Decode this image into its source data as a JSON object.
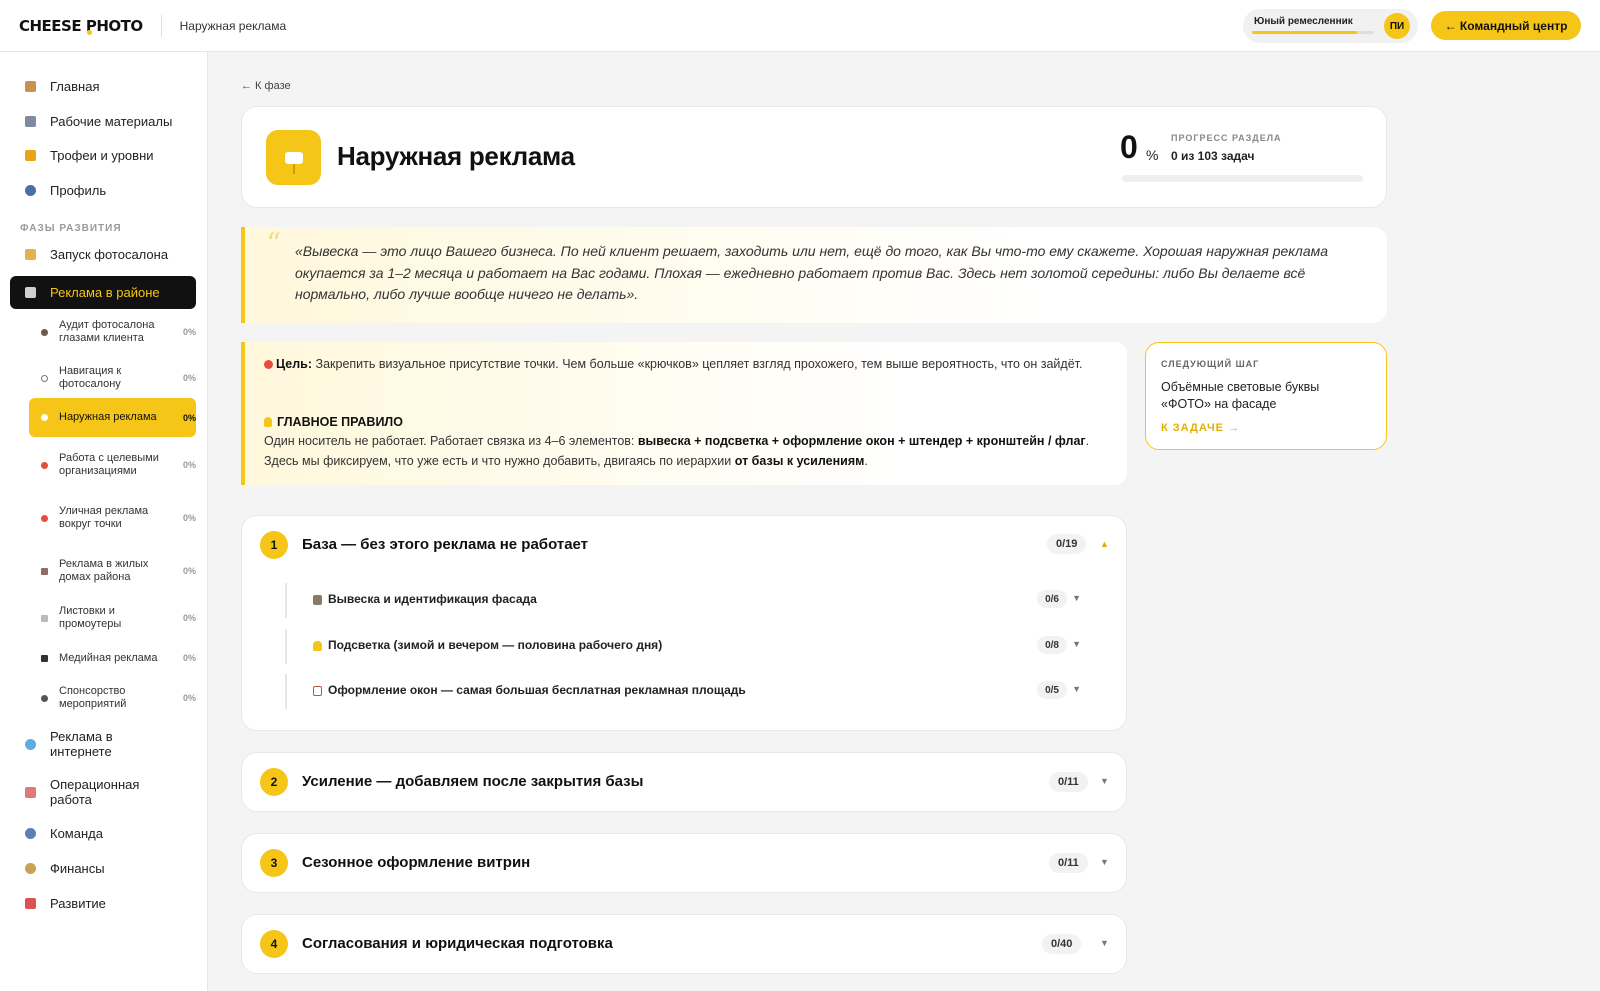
{
  "topbar": {
    "logo": "CHEESE PHOTO",
    "breadcrumb": "Наружная реклама",
    "rank_name": "Юный ремесленник",
    "rank_progress": 0.86,
    "avatar_initials": "ПИ",
    "command_button": "← Командный центр"
  },
  "sidebar": {
    "main_items": [
      {
        "label": "Главная",
        "icon": "home-icon"
      },
      {
        "label": "Рабочие материалы",
        "icon": "folder-icon"
      },
      {
        "label": "Трофеи и уровни",
        "icon": "trophy-icon"
      },
      {
        "label": "Профиль",
        "icon": "user-icon"
      }
    ],
    "section_label": "ФАЗЫ РАЗВИТИЯ",
    "phase_items": [
      {
        "label": "Запуск фотосалона",
        "icon": "flag-icon"
      },
      {
        "label": "Реклама в районе",
        "icon": "store-icon"
      }
    ],
    "sub_items": [
      {
        "label": "Аудит фотосалона глазами клиента",
        "pct": "0%"
      },
      {
        "label": "Навигация к фотосалону",
        "pct": "0%"
      },
      {
        "label": "Наружная реклама",
        "pct": "0%"
      },
      {
        "label": "Работа с целевыми организациями",
        "pct": "0%"
      },
      {
        "label": "Уличная реклама вокруг точки",
        "pct": "0%"
      },
      {
        "label": "Реклама в жилых домах района",
        "pct": "0%"
      },
      {
        "label": "Листовки и промоутеры",
        "pct": "0%"
      },
      {
        "label": "Медийная реклама",
        "pct": "0%"
      },
      {
        "label": "Спонсорство мероприятий",
        "pct": "0%"
      }
    ],
    "other_phases": [
      {
        "label": "Реклама в интернете",
        "icon": "globe-icon"
      },
      {
        "label": "Операционная работа",
        "icon": "chart-icon"
      },
      {
        "label": "Команда",
        "icon": "team-icon"
      },
      {
        "label": "Финансы",
        "icon": "money-bag-icon"
      },
      {
        "label": "Развитие",
        "icon": "rocket-icon"
      }
    ]
  },
  "main": {
    "back_link": "← К фазе",
    "title": "Наружная реклама",
    "progress_value": "0",
    "progress_unit": "%",
    "progress_label": "ПРОГРЕСС РАЗДЕЛА",
    "progress_count": "0 из 103 задач",
    "progress_fraction": 0,
    "quote": "«Вывеска — это лицо Вашего бизнеса. По ней клиент решает, заходить или нет, ещё до того, как Вы что-то ему скажете. Хорошая наружная реклама окупается за 1–2 месяца и работает на Вас годами. Плохая — ежедневно работает против Вас. Здесь нет золотой середины: либо Вы делаете всё нормально, либо лучше вообще ничего не делать».",
    "goal_label": "Цель:",
    "goal_text": "Закрепить визуальное присутствие точки. Чем больше «крючков» цепляет взгляд прохожего, тем выше вероятность, что он зайдёт.",
    "rule_label": "ГЛАВНОЕ ПРАВИЛО",
    "rule_text_1": "Один носитель не работает. Работает связка из 4–6 элементов: ",
    "rule_bold_1": "вывеска + подсветка + оформление окон + штендер + кронштейн / флаг",
    "rule_text_2": ". Здесь мы фиксируем, что уже есть и что нужно добавить, двигаясь по иерархии ",
    "rule_bold_2": "от базы к усилениям",
    "rule_text_3": ".",
    "next_step": {
      "label": "СЛЕДУЮЩИЙ ШАГ",
      "title": "Объёмные световые буквы «ФОТО» на фасаде",
      "link": "К ЗАДАЧЕ →"
    },
    "stages": [
      {
        "num": "1",
        "title": "База — без этого реклама не работает",
        "count": "0/19",
        "expanded": true,
        "subs": [
          {
            "title": "Вывеска и идентификация фасада",
            "count": "0/6",
            "icon": "bank-icon"
          },
          {
            "title": "Подсветка (зимой и вечером — половина рабочего дня)",
            "count": "0/8",
            "icon": "bulb-icon"
          },
          {
            "title": "Оформление окон — самая большая бесплатная рекламная площадь",
            "count": "0/5",
            "icon": "door-icon"
          }
        ]
      },
      {
        "num": "2",
        "title": "Усиление — добавляем после закрытия базы",
        "count": "0/11"
      },
      {
        "num": "3",
        "title": "Сезонное оформление витрин",
        "count": "0/11"
      },
      {
        "num": "4",
        "title": "Согласования и юридическая подготовка",
        "count": "0/40"
      }
    ]
  },
  "colors": {
    "accent": "#f5c518",
    "dark": "#111111",
    "background": "#f4f4f5"
  }
}
